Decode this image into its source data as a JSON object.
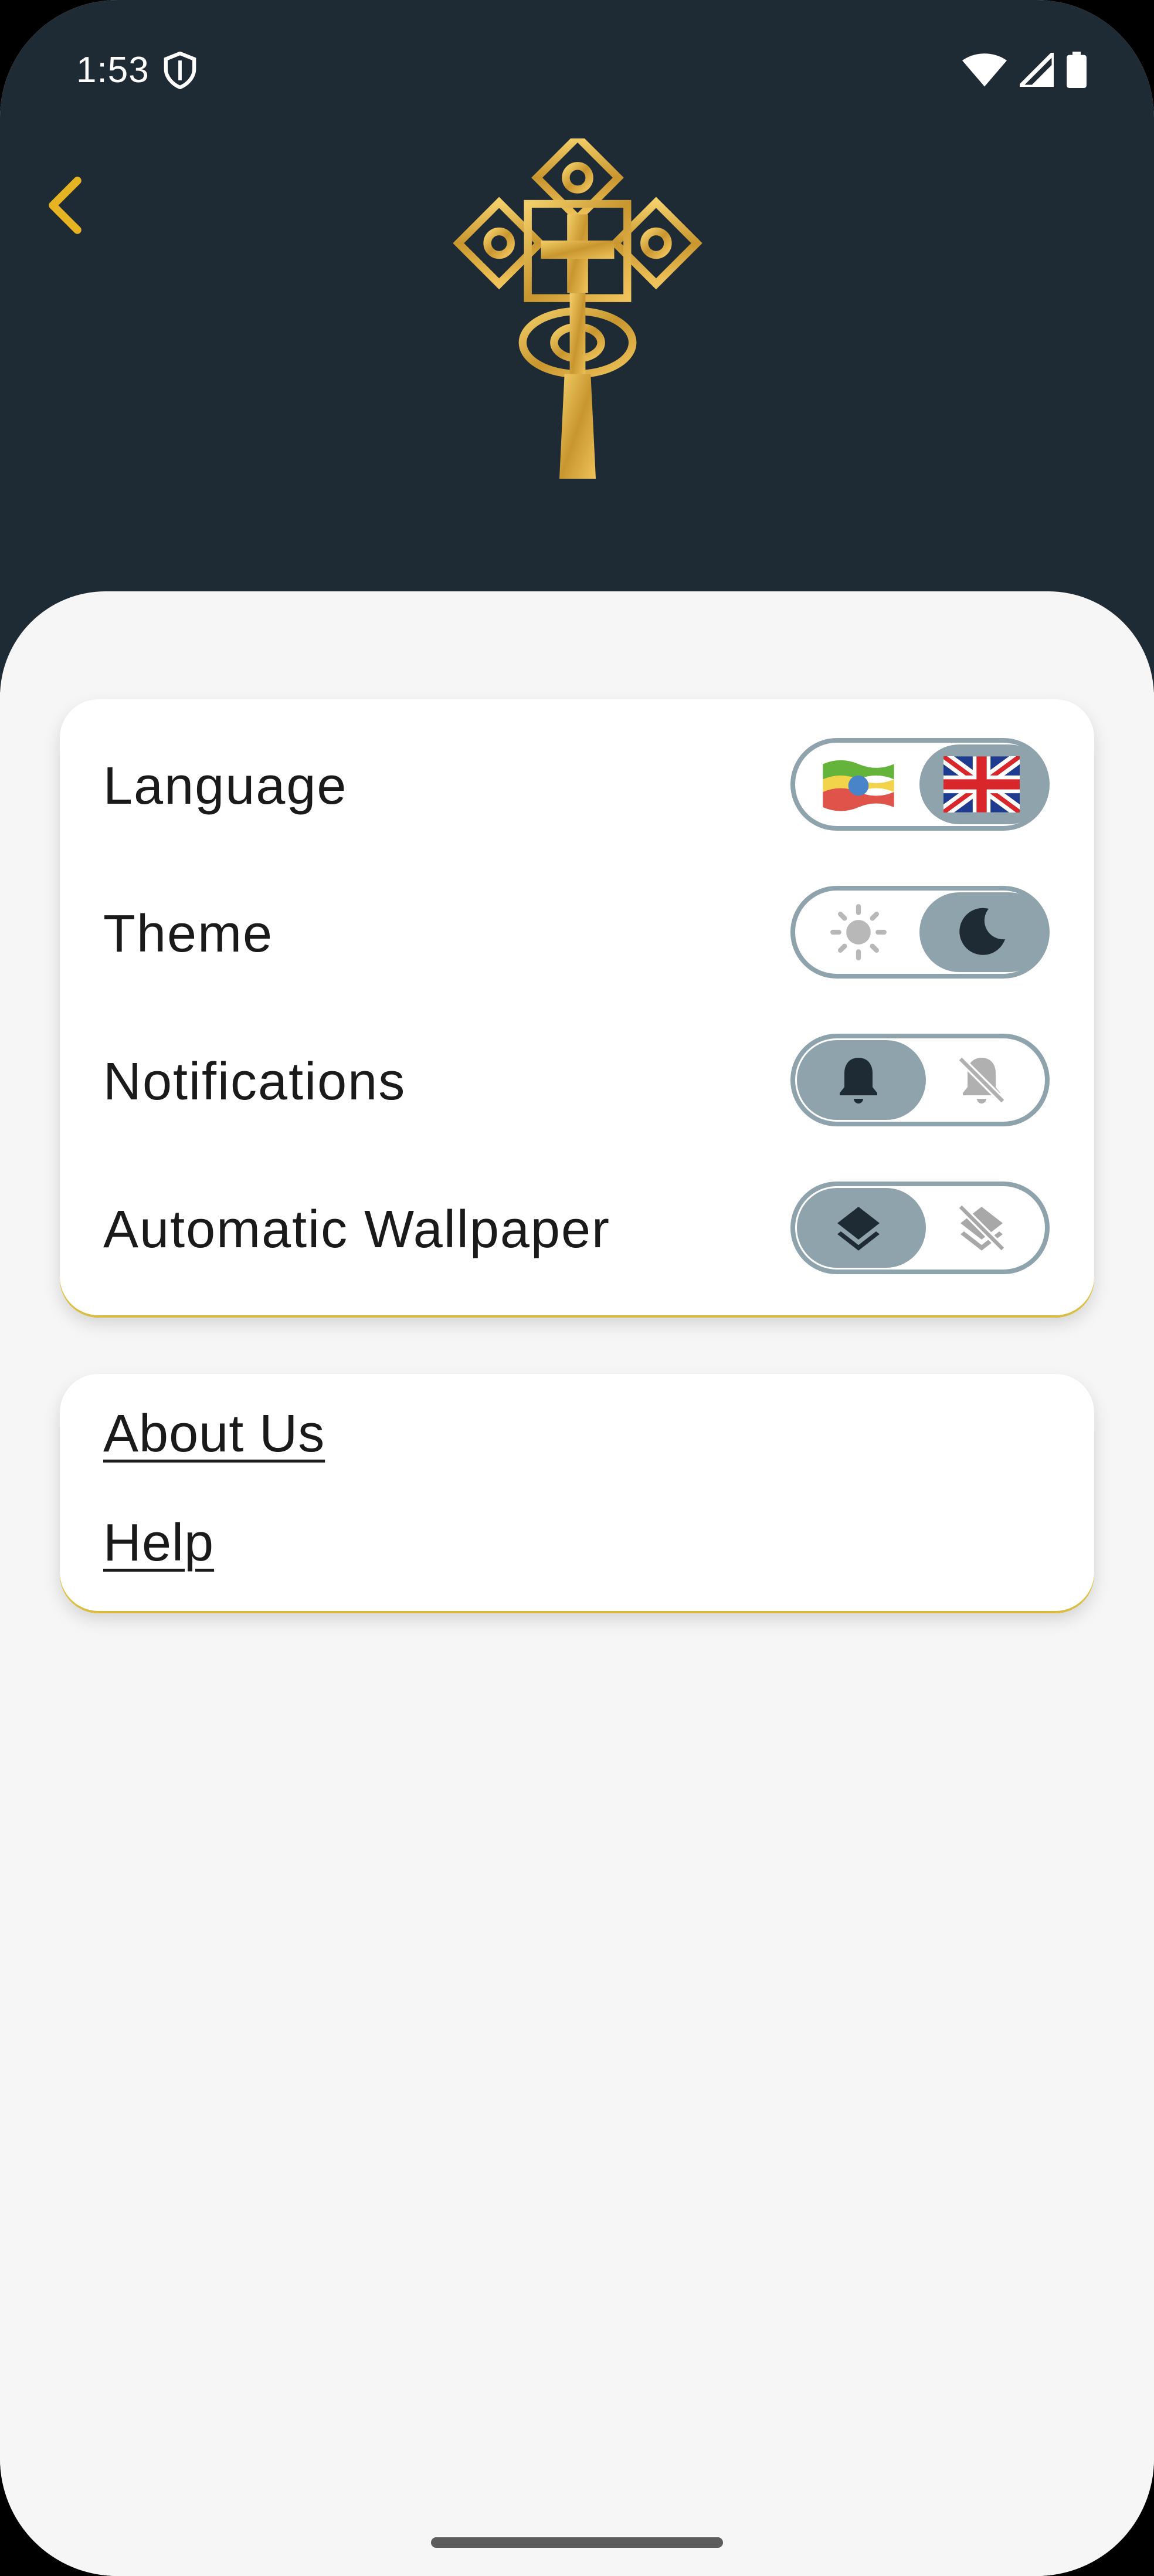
{
  "status_bar": {
    "time": "1:53"
  },
  "header": {
    "back_icon": "chevron-left-icon",
    "logo": "ethiopian-cross-logo"
  },
  "settings": {
    "rows": [
      {
        "label": "Language",
        "left_icon": "ethiopia-flag-icon",
        "right_icon": "uk-flag-icon",
        "selected": "right"
      },
      {
        "label": "Theme",
        "left_icon": "sun-icon",
        "right_icon": "moon-icon",
        "selected": "right"
      },
      {
        "label": "Notifications",
        "left_icon": "bell-icon",
        "right_icon": "bell-off-icon",
        "selected": "left"
      },
      {
        "label": "Automatic Wallpaper",
        "left_icon": "layers-icon",
        "right_icon": "layers-off-icon",
        "selected": "left"
      }
    ]
  },
  "links": {
    "about": "About Us",
    "help": "Help"
  },
  "colors": {
    "header": "#1f2b34",
    "accent": "#e6b422",
    "toggle": "#8fa3ad",
    "card_underline": "#f2d44a"
  }
}
